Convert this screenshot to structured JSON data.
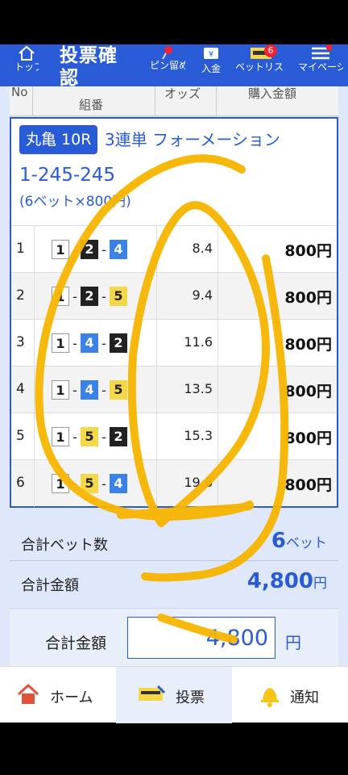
{
  "header": {
    "top_label": "トップ",
    "title": "投票確認",
    "pin_label": "ピン留め",
    "deposit_label": "入金",
    "betlist_label": "ベットリスト",
    "betlist_badge": "6",
    "mypage_label": "マイページ"
  },
  "columns": {
    "no": "No",
    "combo": "組番",
    "odds": "オッズ",
    "amount": "購入金額"
  },
  "bet": {
    "race": "丸亀 10R",
    "type": "3連単 フォーメーション",
    "combination": "1-245-245",
    "detail": "(6ベット×800円)"
  },
  "rows": [
    {
      "no": "1",
      "b1": "1",
      "b2": "2",
      "b3": "4",
      "odds": "8.4",
      "amount": "800円"
    },
    {
      "no": "2",
      "b1": "1",
      "b2": "2",
      "b3": "5",
      "odds": "9.4",
      "amount": "800円"
    },
    {
      "no": "3",
      "b1": "1",
      "b2": "4",
      "b3": "2",
      "odds": "11.6",
      "amount": "800円"
    },
    {
      "no": "4",
      "b1": "1",
      "b2": "4",
      "b3": "5",
      "odds": "13.5",
      "amount": "800円"
    },
    {
      "no": "5",
      "b1": "1",
      "b2": "5",
      "b3": "2",
      "odds": "15.3",
      "amount": "800円"
    },
    {
      "no": "6",
      "b1": "1",
      "b2": "5",
      "b3": "4",
      "odds": "19.6",
      "amount": "800円"
    }
  ],
  "summary": {
    "count_label": "合計ベット数",
    "count_value": "6",
    "count_unit": "ベット",
    "amount_label": "合計金額",
    "amount_value": "4,800",
    "amount_unit": "円"
  },
  "total": {
    "label": "合計金額",
    "value": "4,800",
    "unit": "円"
  },
  "nav": {
    "home": "ホーム",
    "vote": "投票",
    "notify": "通知"
  },
  "colors": {
    "primary": "#2a5bd7",
    "annotation": "#f7b500",
    "boat_1": "#ffffff",
    "boat_2": "#222222",
    "boat_4": "#3b82e6",
    "boat_5": "#f5d84a"
  }
}
